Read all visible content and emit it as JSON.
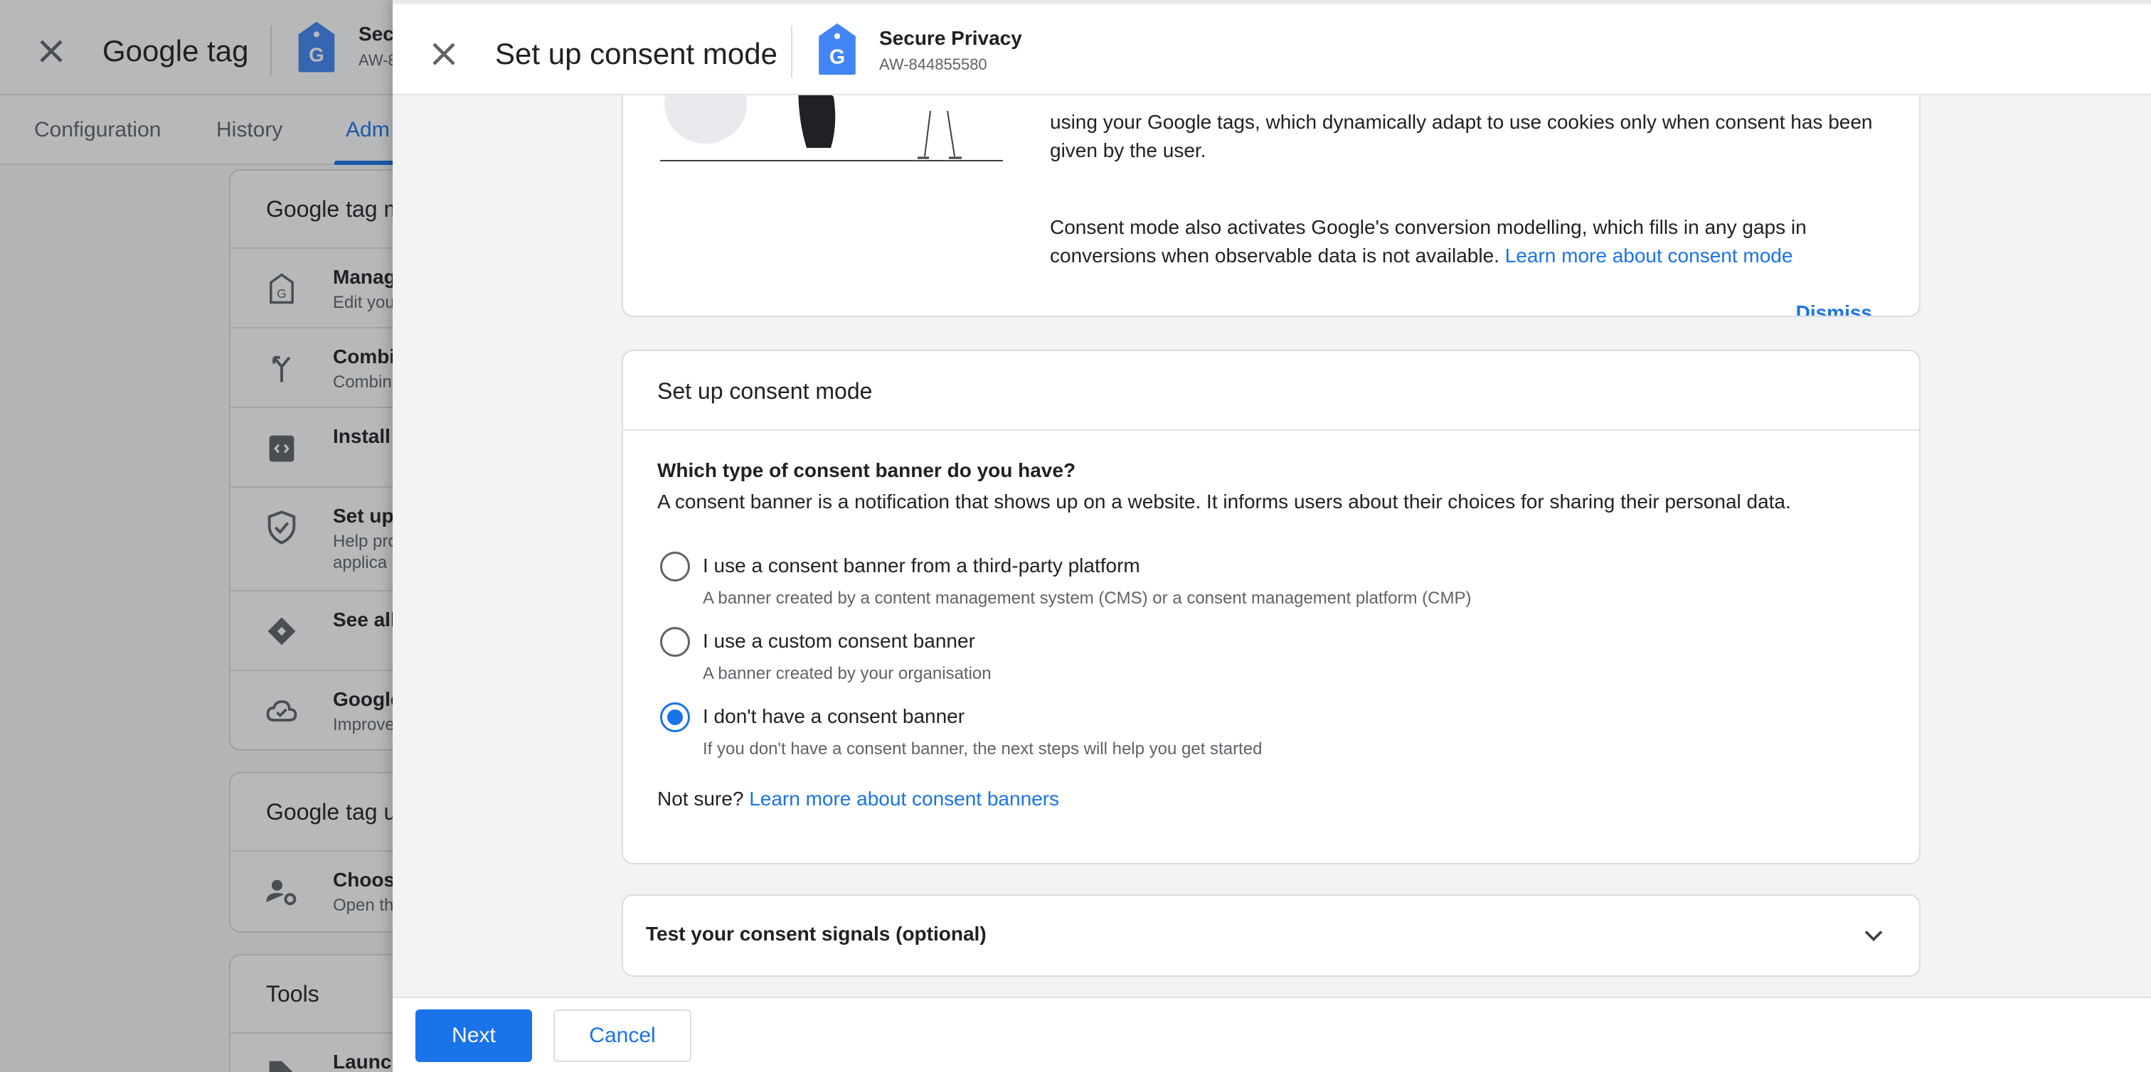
{
  "background": {
    "header": {
      "title": "Google tag",
      "tag_name": "Sec",
      "tag_id": "AW-8"
    },
    "tabs": [
      {
        "label": "Configuration"
      },
      {
        "label": "History"
      },
      {
        "label": "Adm"
      }
    ],
    "cards": [
      {
        "title": "Google tag m",
        "rows": [
          {
            "title": "Manag",
            "subtitle": "Edit you",
            "icon": "google-tag-icon"
          },
          {
            "title": "Combi",
            "subtitle": "Combin",
            "icon": "merge-icon"
          },
          {
            "title": "Install",
            "subtitle": "",
            "icon": "code-clipboard-icon"
          },
          {
            "title": "Set up",
            "subtitle": "Help pro",
            "subtitle2": "applica",
            "icon": "shield-check-icon"
          },
          {
            "title": "See all",
            "subtitle": "",
            "icon": "diamond-icon"
          },
          {
            "title": "Google",
            "subtitle": "Improve",
            "icon": "cloud-check-icon"
          }
        ]
      },
      {
        "title": "Google tag u",
        "rows": [
          {
            "title": "Choos",
            "subtitle": "Open th",
            "icon": "user-settings-icon"
          }
        ]
      },
      {
        "title": "Tools",
        "rows": [
          {
            "title": "Launch",
            "subtitle": "",
            "icon": "tag-icon"
          }
        ]
      }
    ]
  },
  "sheet": {
    "title": "Set up consent mode",
    "tag_name": "Secure Privacy",
    "tag_id": "AW-844855580",
    "intro": {
      "p1": "using your Google tags, which dynamically adapt to use cookies only when consent has been given by the user.",
      "p2": "Consent mode also activates Google's conversion modelling, which fills in any gaps in conversions when observable data is not available.",
      "p2_link": "Learn more about consent mode",
      "dismiss": "Dismiss"
    },
    "setup": {
      "title": "Set up consent mode",
      "question": "Which type of consent banner do you have?",
      "description": "A consent banner is a notification that shows up on a website. It informs users about their choices for sharing their personal data.",
      "options": [
        {
          "label": "I use a consent banner from a third-party platform",
          "sub": "A banner created by a content management system (CMS) or a consent management platform (CMP)",
          "selected": false
        },
        {
          "label": "I use a custom consent banner",
          "sub": "A banner created by your organisation",
          "selected": false
        },
        {
          "label": "I don't have a consent banner",
          "sub": "If you don't have a consent banner, the next steps will help you get started",
          "selected": true
        }
      ],
      "not_sure": "Not sure?",
      "not_sure_link": "Learn more about consent banners"
    },
    "test": {
      "title": "Test your consent signals (optional)"
    },
    "footer": {
      "next": "Next",
      "cancel": "Cancel"
    }
  },
  "colors": {
    "accent": "#1a73e8",
    "tag_blue": "#4285f4"
  }
}
